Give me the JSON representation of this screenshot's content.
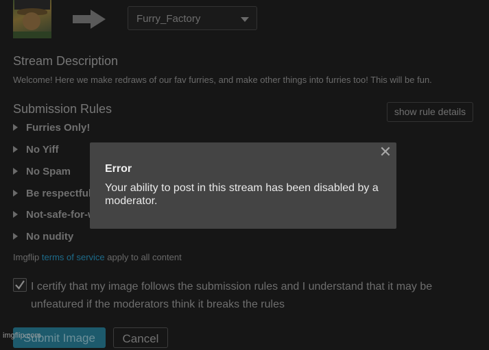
{
  "header": {
    "thumbnail_icon": "meme-thumbnail-image",
    "arrow_icon": "right-arrow-icon",
    "stream_select": {
      "value": "Furry_Factory"
    }
  },
  "description": {
    "heading": "Stream Description",
    "text": "Welcome! Here we make redraws of our fav furries, and make other things into furries too! This will be fun."
  },
  "rules": {
    "heading": "Submission Rules",
    "show_details_label": "show rule details",
    "items": [
      {
        "label": "Furries Only!"
      },
      {
        "label": "No Yiff"
      },
      {
        "label": "No Spam"
      },
      {
        "label": "Be respectful"
      },
      {
        "label": "Not-safe-for-work"
      },
      {
        "label": "No nudity"
      }
    ]
  },
  "tos": {
    "prefix": "Imgflip",
    "link": "terms of service",
    "suffix": "apply to all content"
  },
  "certify": {
    "checked": true,
    "text": "I certify that my image follows the submission rules and I understand that it may be unfeatured if the moderators think it breaks the rules"
  },
  "buttons": {
    "submit_label": "Submit Image",
    "cancel_label": "Cancel"
  },
  "watermark": "imgflip.com",
  "modal": {
    "title": "Error",
    "message": "Your ability to post in this stream has been disabled by a moderator.",
    "close_glyph": "✕"
  },
  "colors": {
    "background": "#161616",
    "modal_bg": "#444444",
    "link": "#1d6b8a",
    "submit_bg": "#1d5a6c"
  }
}
